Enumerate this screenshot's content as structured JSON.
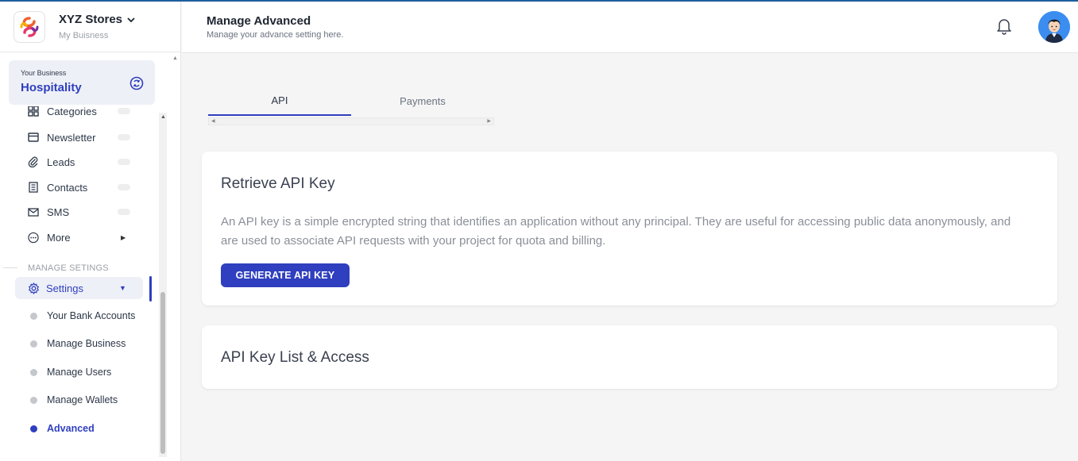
{
  "brand": {
    "name": "XYZ Stores",
    "subtitle": "My Buisness"
  },
  "business": {
    "label": "Your Business",
    "name": "Hospitality"
  },
  "nav": {
    "partial_item": "Categories",
    "items": [
      {
        "label": "Newsletter",
        "icon": "card-icon"
      },
      {
        "label": "Leads",
        "icon": "paperclip-icon"
      },
      {
        "label": "Contacts",
        "icon": "contacts-icon"
      },
      {
        "label": "SMS",
        "icon": "mail-icon"
      },
      {
        "label": "More",
        "icon": "more-icon"
      }
    ],
    "section_label": "MANAGE SETINGS",
    "settings_label": "Settings",
    "sub_items": [
      {
        "label": "Your Bank Accounts"
      },
      {
        "label": "Manage Business"
      },
      {
        "label": "Manage Users"
      },
      {
        "label": "Manage Wallets"
      },
      {
        "label": "Advanced"
      }
    ]
  },
  "header": {
    "title": "Manage Advanced",
    "subtitle": "Manage your advance setting here."
  },
  "tabs": [
    {
      "label": "API"
    },
    {
      "label": "Payments"
    }
  ],
  "api_card": {
    "title": "Retrieve API Key",
    "description": "An API key is a simple encrypted string that identifies an application without any principal. They are useful for accessing public data anonymously, and are used to associate API requests with your project for quota and billing.",
    "button_label": "GENERATE API KEY"
  },
  "list_card": {
    "title": "API Key List & Access"
  },
  "colors": {
    "accent": "#2f3fbf",
    "top_bar": "#1f5f9c",
    "avatar_bg": "#3b8df0"
  }
}
